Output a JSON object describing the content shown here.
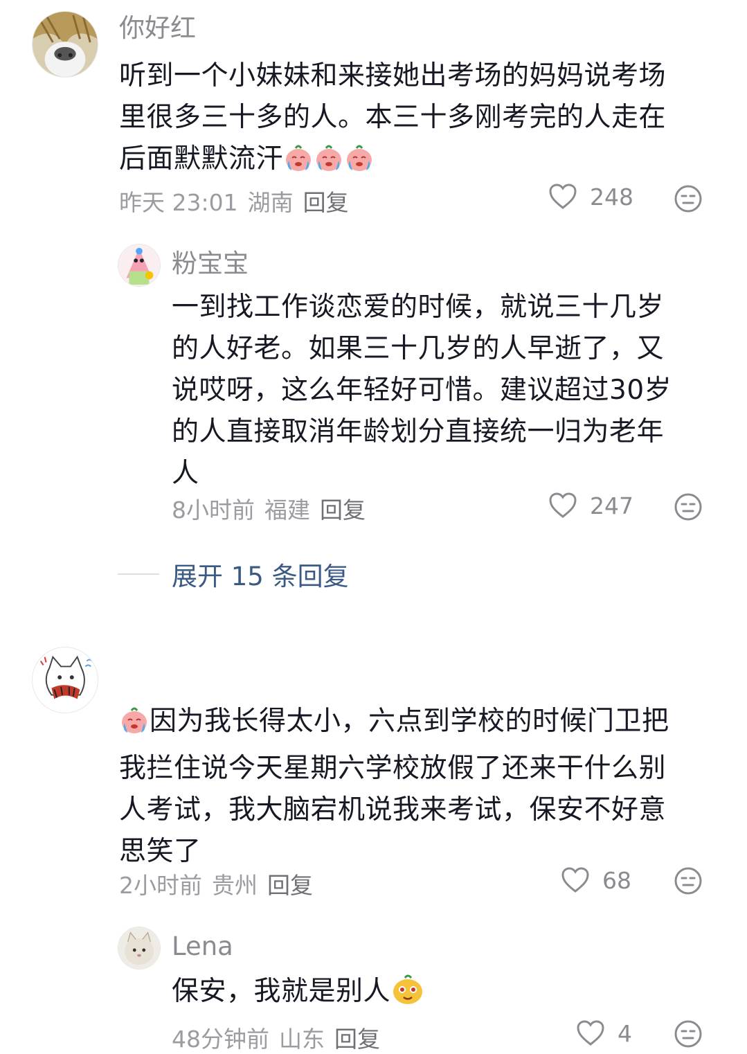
{
  "comments": [
    {
      "user": "你好红",
      "text_line1": "听到一个小妹妹和来接她出考场的妈妈说考场",
      "text_line2": "里很多三十多的人。本三十多刚考完的人走在",
      "text_line3": "后面默默流汗",
      "time": "昨天 23:01",
      "location": "湖南",
      "reply_label": "回复",
      "likes": "248",
      "replies": [
        {
          "user": "粉宝宝",
          "text_line1": "一到找工作谈恋爱的时候，就说三十几岁",
          "text_line2": "的人好老。如果三十几岁的人早逝了，又",
          "text_line3": "说哎呀，这么年轻好可惜。建议超过30岁",
          "text_line4": "的人直接取消年龄划分直接统一归为老年",
          "text_line5": "人",
          "time": "8小时前",
          "location": "福建",
          "reply_label": "回复",
          "likes": "247"
        }
      ],
      "expand_label": "展开 15 条回复"
    },
    {
      "user": "",
      "text_line1": "因为我长得太小，六点到学校的时候门卫把",
      "text_line2": "我拦住说今天星期六学校放假了还来干什么别",
      "text_line3": "人考试，我大脑宕机说我来考试，保安不好意",
      "text_line4": "思笑了",
      "time": "2小时前",
      "location": "贵州",
      "reply_label": "回复",
      "likes": "68",
      "replies": [
        {
          "user": "Lena",
          "text_line1": "保安，我就是别人",
          "time": "48分钟前",
          "location": "山东",
          "reply_label": "回复",
          "likes": "4"
        }
      ]
    }
  ],
  "icons": {
    "like": "heart-outline-icon",
    "dislike": "dislike-face-icon",
    "emoji_cry": "crying-peach-emoji",
    "emoji_smile": "smiling-peach-emoji"
  },
  "colors": {
    "text": "#161823",
    "meta": "#9b9ca1",
    "name": "#8a8b91",
    "expand": "#3a5a84"
  }
}
